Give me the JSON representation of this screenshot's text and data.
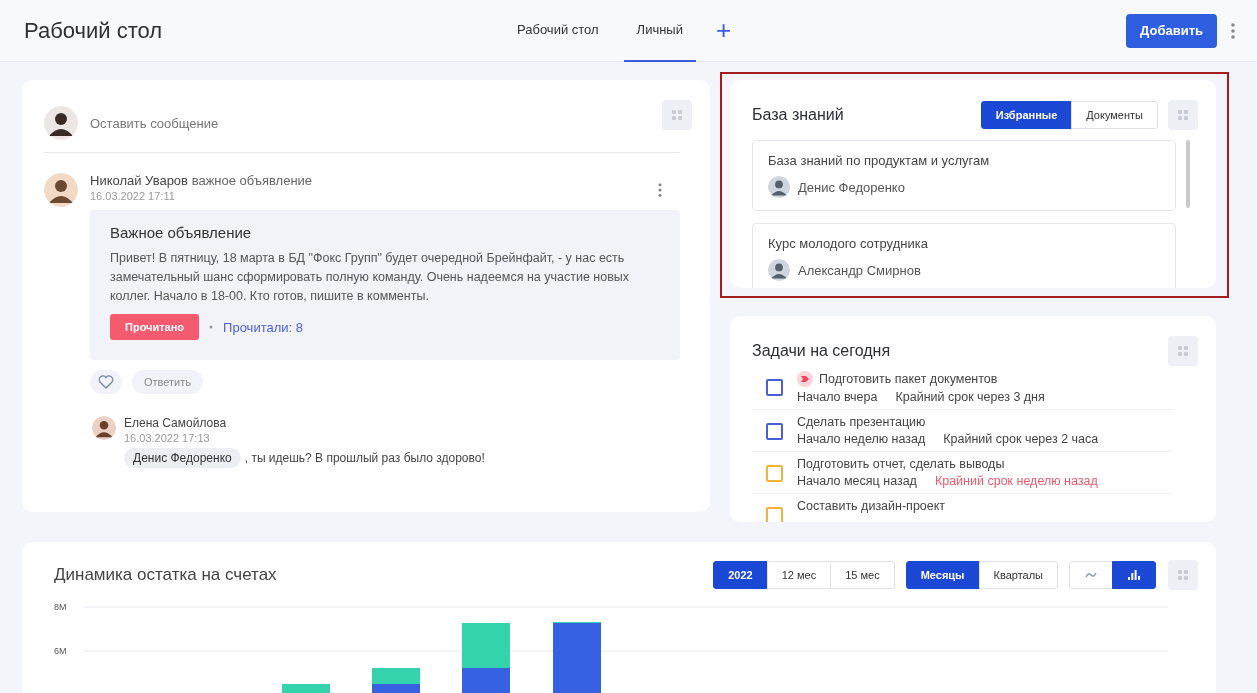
{
  "header": {
    "title": "Рабочий стол",
    "tabs": [
      {
        "label": "Рабочий стол",
        "selected": false
      },
      {
        "label": "Личный",
        "selected": true
      }
    ],
    "add_tab": "+",
    "add_button": "Добавить"
  },
  "feed": {
    "composer": {
      "placeholder": "Оставить сообщение"
    },
    "post": {
      "author": "Николай Уваров",
      "action": "важное объявление",
      "time": "16.03.2022 17:11",
      "title": "Важное объявление",
      "text": "Привет! В пятницу, 18 марта в БД \"Фокс Групп\" будет очередной Брейнфайт, - у нас есть замечательный шанс сформировать полную команду. Очень надеемся на участие новых коллег. Начало в 18-00. Кто готов, пишите в комменты.",
      "read_button": "Прочитано",
      "readers": "Прочитали: 8",
      "liked": false,
      "reply": "Ответить"
    },
    "comment": {
      "author": "Елена Самойлова",
      "time": "16.03.2022 17:13",
      "mention": "Денис Федоренко",
      "text": ", ты идешь? В прошлый раз было здорово!"
    }
  },
  "knowledge_base": {
    "title": "База знаний",
    "highlighted": true,
    "tabs": [
      {
        "label": "Избранные",
        "selected": true
      },
      {
        "label": "Документы",
        "selected": false
      }
    ],
    "items": [
      {
        "title": "База знаний по продуктам и услугам",
        "author": "Денис Федоренко"
      },
      {
        "title": "Курс молодого сотрудника",
        "author": "Александр Смирнов"
      }
    ]
  },
  "tasks": {
    "title": "Задачи на сегодня",
    "items": [
      {
        "title": "Подготовить пакет документов",
        "flagged": true,
        "color": "#4a5fd6",
        "start": "Начало вчера",
        "deadline": "Крайний срок через 3 дня",
        "overdue": false
      },
      {
        "title": "Сделать презентацию",
        "flagged": false,
        "color": "#4a5fd6",
        "start": "Начало неделю назад",
        "deadline": "Крайний срок через 2 часа",
        "overdue": false
      },
      {
        "title": "Подготовить отчет, сделать выводы",
        "flagged": false,
        "color": "#f5b335",
        "start": "Начало месяц назад",
        "deadline": "Крайний срок неделю назад",
        "overdue": true
      },
      {
        "title": "Составить дизайн-проект",
        "flagged": false,
        "color": "#f5b335"
      }
    ]
  },
  "balance": {
    "title": "Динамика остатка на счетах",
    "periods": [
      {
        "label": "2022",
        "selected": true
      },
      {
        "label": "12 мес",
        "selected": false
      },
      {
        "label": "15 мес",
        "selected": false
      }
    ],
    "groupings": [
      {
        "label": "Месяцы",
        "selected": true
      },
      {
        "label": "Кварталы",
        "selected": false
      }
    ],
    "views": [
      {
        "kind": "line",
        "selected": false
      },
      {
        "kind": "bar",
        "selected": true
      }
    ],
    "axis_labels": [
      "8M",
      "6M"
    ]
  }
}
